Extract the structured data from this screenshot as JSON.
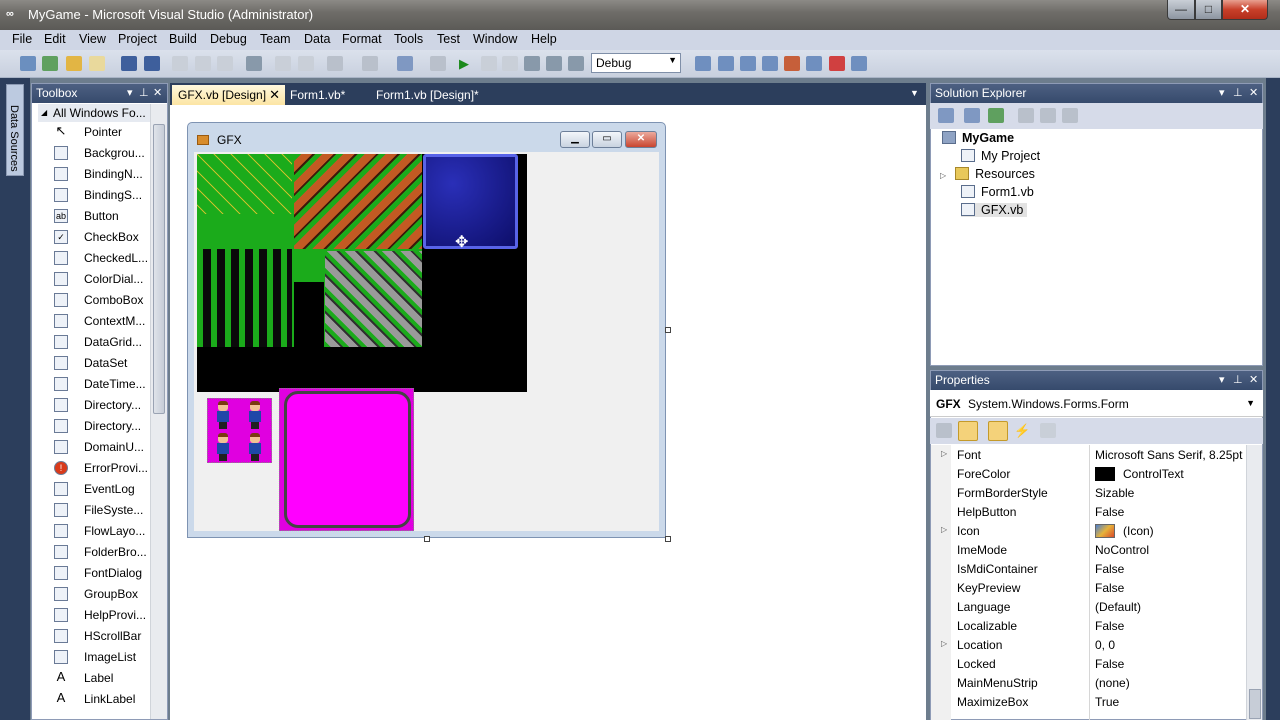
{
  "window": {
    "title": "MyGame - Microsoft Visual Studio (Administrator)"
  },
  "menu": [
    "File",
    "Edit",
    "View",
    "Project",
    "Build",
    "Debug",
    "Team",
    "Data",
    "Format",
    "Tools",
    "Test",
    "Window",
    "Help"
  ],
  "toolbar": {
    "configuration": "Debug"
  },
  "side": {
    "data_sources": "Data Sources"
  },
  "toolbox": {
    "title": "Toolbox",
    "category": "All Windows Fo...",
    "items": [
      "Pointer",
      "Backgrou...",
      "BindingN...",
      "BindingS...",
      "Button",
      "CheckBox",
      "CheckedL...",
      "ColorDial...",
      "ComboBox",
      "ContextM...",
      "DataGrid...",
      "DataSet",
      "DateTime...",
      "Directory...",
      "Directory...",
      "DomainU...",
      "ErrorProvi...",
      "EventLog",
      "FileSyste...",
      "FlowLayo...",
      "FolderBro...",
      "FontDialog",
      "GroupBox",
      "HelpProvi...",
      "HScrollBar",
      "ImageList",
      "Label",
      "LinkLabel"
    ]
  },
  "tabs": [
    "GFX.vb [Design]",
    "Form1.vb*",
    "Form1.vb [Design]*"
  ],
  "form": {
    "title": "GFX"
  },
  "solution": {
    "title": "Solution Explorer",
    "project": "MyGame",
    "items": [
      "My Project",
      "Resources",
      "Form1.vb",
      "GFX.vb"
    ]
  },
  "properties": {
    "title": "Properties",
    "object_name": "GFX",
    "object_type": "System.Windows.Forms.Form",
    "rows": [
      {
        "name": "Font",
        "value": "Microsoft Sans Serif, 8.25pt"
      },
      {
        "name": "ForeColor",
        "value": "ControlText"
      },
      {
        "name": "FormBorderStyle",
        "value": "Sizable"
      },
      {
        "name": "HelpButton",
        "value": "False"
      },
      {
        "name": "Icon",
        "value": "(Icon)"
      },
      {
        "name": "ImeMode",
        "value": "NoControl"
      },
      {
        "name": "IsMdiContainer",
        "value": "False"
      },
      {
        "name": "KeyPreview",
        "value": "False"
      },
      {
        "name": "Language",
        "value": "(Default)"
      },
      {
        "name": "Localizable",
        "value": "False"
      },
      {
        "name": "Location",
        "value": "0, 0"
      },
      {
        "name": "Locked",
        "value": "False"
      },
      {
        "name": "MainMenuStrip",
        "value": "(none)"
      },
      {
        "name": "MaximizeBox",
        "value": "True"
      }
    ]
  }
}
